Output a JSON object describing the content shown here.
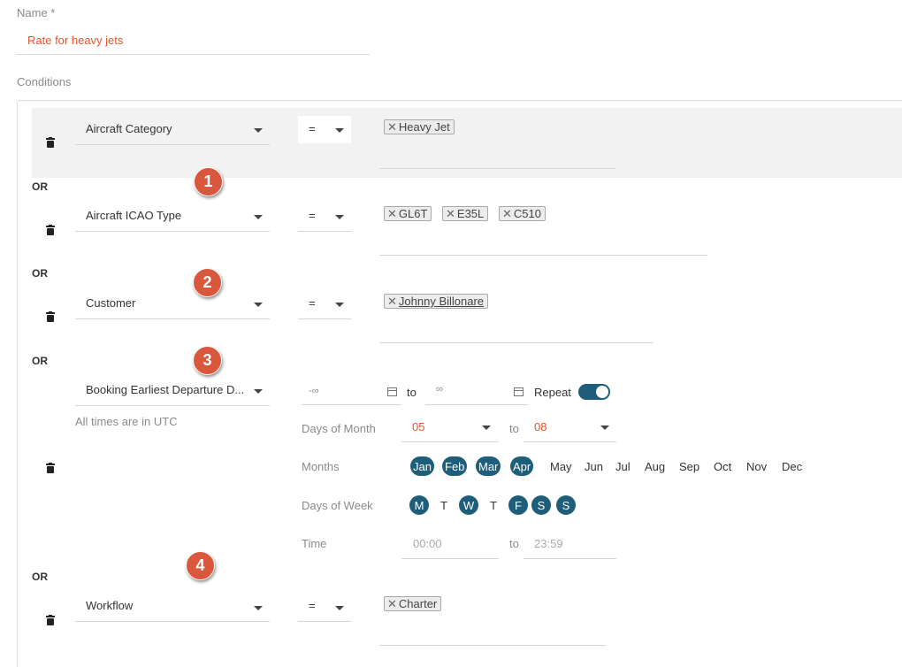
{
  "name_field": {
    "label": "Name *",
    "value": "Rate for heavy jets"
  },
  "conditions_label": "Conditions",
  "or_label": "OR",
  "colors": {
    "accent": "#1f5e7a",
    "marker": "#d9573c",
    "value_text": "#e0562f"
  },
  "markers": [
    "1",
    "2",
    "3",
    "4"
  ],
  "conditions": [
    {
      "field": "Aircraft Category",
      "operator": "=",
      "chips": [
        "Heavy Jet"
      ]
    },
    {
      "field": "Aircraft ICAO Type",
      "operator": "=",
      "chips": [
        "GL6T",
        "E35L",
        "C510"
      ]
    },
    {
      "field": "Customer",
      "operator": "=",
      "chips": [
        "Johnny Billonare"
      ]
    },
    {
      "field": "Booking Earliest Departure D...",
      "note": "All times are in UTC",
      "range_from": "-∞",
      "to_label": "to",
      "range_to": "∞",
      "repeat_label": "Repeat",
      "repeat_on": true,
      "days_of_month": {
        "label": "Days of Month",
        "from": "05",
        "to": "08"
      },
      "months": {
        "label": "Months",
        "items": [
          {
            "label": "Jan",
            "selected": true
          },
          {
            "label": "Feb",
            "selected": true
          },
          {
            "label": "Mar",
            "selected": true
          },
          {
            "label": "Apr",
            "selected": true
          },
          {
            "label": "May",
            "selected": false
          },
          {
            "label": "Jun",
            "selected": false
          },
          {
            "label": "Jul",
            "selected": false
          },
          {
            "label": "Aug",
            "selected": false
          },
          {
            "label": "Sep",
            "selected": false
          },
          {
            "label": "Oct",
            "selected": false
          },
          {
            "label": "Nov",
            "selected": false
          },
          {
            "label": "Dec",
            "selected": false
          }
        ]
      },
      "days_of_week": {
        "label": "Days of Week",
        "items": [
          {
            "label": "M",
            "selected": true
          },
          {
            "label": "T",
            "selected": false
          },
          {
            "label": "W",
            "selected": true
          },
          {
            "label": "T",
            "selected": false
          },
          {
            "label": "F",
            "selected": true
          },
          {
            "label": "S",
            "selected": true
          },
          {
            "label": "S",
            "selected": true
          }
        ]
      },
      "time": {
        "label": "Time",
        "from_placeholder": "00:00",
        "to_placeholder": "23:59"
      }
    },
    {
      "field": "Workflow",
      "operator": "=",
      "chips": [
        "Charter"
      ]
    }
  ]
}
